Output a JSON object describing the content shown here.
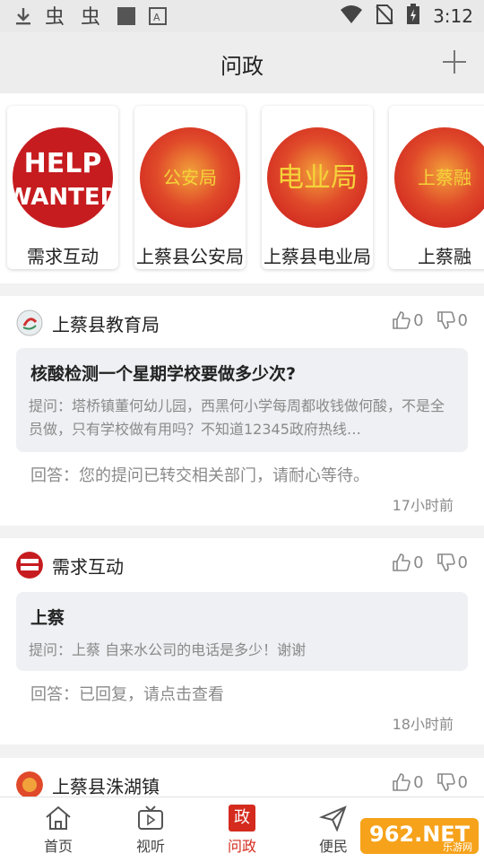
{
  "status_bar": {
    "time": "3:12"
  },
  "header": {
    "title": "问政"
  },
  "departments": [
    {
      "name": "需求互动",
      "logo_text_1": "HELP",
      "logo_text_2": "WANTED"
    },
    {
      "name": "上蔡县公安局",
      "logo_text": "公安局"
    },
    {
      "name": "上蔡县电业局",
      "logo_text": "电业局"
    },
    {
      "name": "上蔡融",
      "logo_text": "上蔡融"
    }
  ],
  "posts": [
    {
      "source": "上蔡县教育局",
      "likes": "0",
      "dislikes": "0",
      "question_title": "核酸检测一个星期学校要做多少次?",
      "question_body": "提问：塔桥镇董何幼儿园，西黑何小学每周都收钱做何酸，不是全员做，只有学校做有用吗？不知道12345政府热线…",
      "answer": "回答：您的提问已转交相关部门，请耐心等待。",
      "time": "17小时前"
    },
    {
      "source": "需求互动",
      "likes": "0",
      "dislikes": "0",
      "question_title": "上蔡",
      "question_body": "提问：上蔡 自来水公司的电话是多少！谢谢",
      "answer": "回答：已回复，请点击查看",
      "time": "18小时前"
    },
    {
      "source": "上蔡县洙湖镇",
      "likes": "0",
      "dislikes": "0"
    }
  ],
  "bottom_nav": {
    "items": [
      {
        "label": "首页",
        "icon": "home-icon"
      },
      {
        "label": "视听",
        "icon": "tv-icon"
      },
      {
        "label": "问政",
        "icon": "wenzheng-icon",
        "icon_text": "政",
        "active": true
      },
      {
        "label": "便民",
        "icon": "send-icon"
      }
    ]
  },
  "watermark": {
    "text": "962.NET",
    "subtext": "乐游网"
  },
  "colors": {
    "accent": "#d42b1e",
    "card_bg": "#eef0f3",
    "muted": "#8a8a8a"
  }
}
